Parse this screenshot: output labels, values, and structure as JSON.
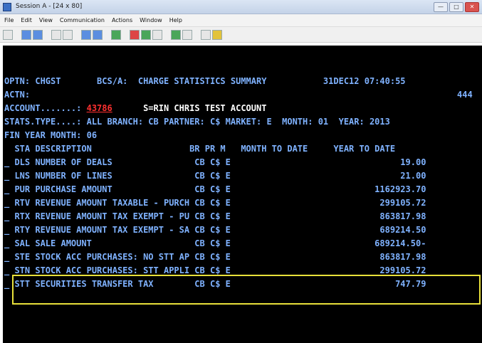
{
  "window": {
    "title": "Session A - [24 x 80]",
    "min": "—",
    "max": "□",
    "close": "✕"
  },
  "menu": [
    "File",
    "Edit",
    "View",
    "Communication",
    "Actions",
    "Window",
    "Help"
  ],
  "terminal": {
    "l1": "OPTN: CHGST       BCS/A:  CHARGE STATISTICS SUMMARY           31DEC12 07:40:55",
    "l2a": "ACTN:",
    "l2b": "444",
    "l3a": "ACCOUNT.......: ",
    "l3b": "43786",
    "l3c": "      S=RIN CHRIS TEST ACCOUNT",
    "l4": "STATS.TYPE....: ALL BRANCH: CB PARTNER: C$ MARKET: E  MONTH: 01  YEAR: 2013",
    "l5": "FIN YEAR MONTH: 06",
    "header": "  STA DESCRIPTION                   BR PR M   MONTH TO DATE     YEAR TO DATE",
    "rows": [
      {
        "code": "DLS",
        "desc": "NUMBER OF DEALS           ",
        "br": "CB",
        "pr": "C$",
        "m": "E",
        "ytd": "19.00"
      },
      {
        "code": "LNS",
        "desc": "NUMBER OF LINES           ",
        "br": "CB",
        "pr": "C$",
        "m": "E",
        "ytd": "21.00"
      },
      {
        "code": "PUR",
        "desc": "PURCHASE AMOUNT           ",
        "br": "CB",
        "pr": "C$",
        "m": "E",
        "ytd": "1162923.70"
      },
      {
        "code": "RTV",
        "desc": "REVENUE AMOUNT TAXABLE - PURCH",
        "br": "CB",
        "pr": "C$",
        "m": "E",
        "ytd": "299105.72"
      },
      {
        "code": "RTX",
        "desc": "REVENUE AMOUNT TAX EXEMPT - PU",
        "br": "CB",
        "pr": "C$",
        "m": "E",
        "ytd": "863817.98"
      },
      {
        "code": "RTY",
        "desc": "REVENUE AMOUNT TAX EXEMPT - SA",
        "br": "CB",
        "pr": "C$",
        "m": "E",
        "ytd": "689214.50"
      },
      {
        "code": "SAL",
        "desc": "SALE AMOUNT               ",
        "br": "CB",
        "pr": "C$",
        "m": "E",
        "ytd": "689214.50-"
      },
      {
        "code": "STE",
        "desc": "STOCK ACC PURCHASES: NO STT AP",
        "br": "CB",
        "pr": "C$",
        "m": "E",
        "ytd": "863817.98"
      },
      {
        "code": "STN",
        "desc": "STOCK ACC PURCHASES: STT APPLI",
        "br": "CB",
        "pr": "C$",
        "m": "E",
        "ytd": "299105.72"
      },
      {
        "code": "STT",
        "desc": "SECURITIES TRANSFER TAX   ",
        "br": "CB",
        "pr": "C$",
        "m": "E",
        "ytd": "747.79"
      }
    ]
  },
  "colors": {
    "terminal_bg": "#000000",
    "terminal_text": "#7fb2ff",
    "highlight": "#e8e03a",
    "account": "#ff3030"
  }
}
